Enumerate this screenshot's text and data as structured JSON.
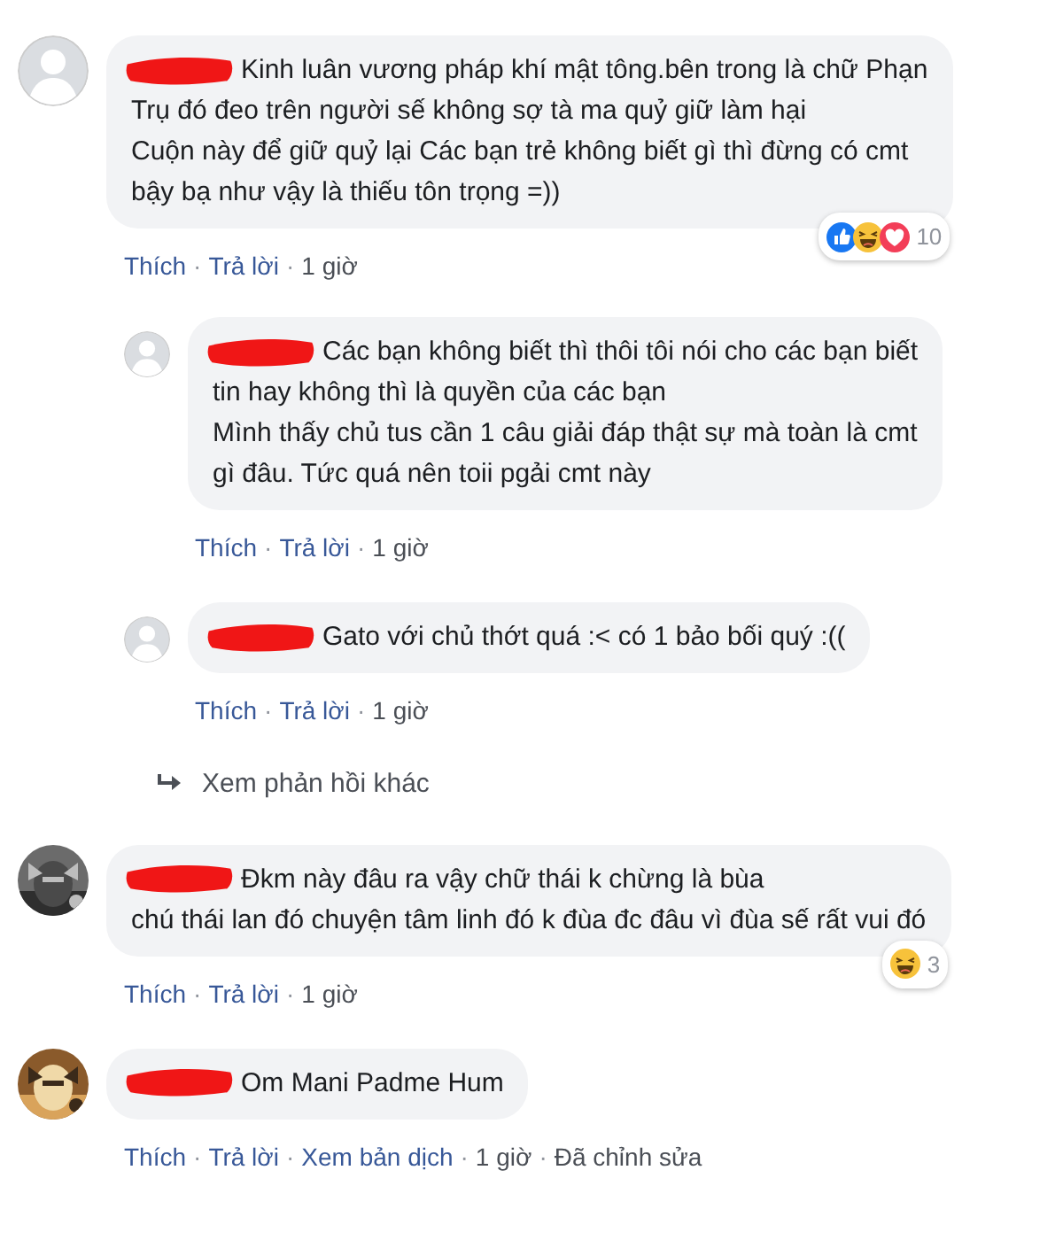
{
  "comments": [
    {
      "avatar": {
        "kind": "default"
      },
      "lines": [
        "Kinh luân vương pháp khí mật tông.bên trong là chữ Phạn",
        "Trụ đó đeo trên người sế không sợ tà ma quỷ giữ làm hại",
        "Cuộn này để giữ quỷ lại Các bạn trẻ không biết gì thì đừng có cmt",
        "bậy bạ như vậy là thiếu tôn trọng =))"
      ],
      "actions": [
        "Thích",
        "Trả lời",
        "1 giờ"
      ],
      "reactions": {
        "icons": [
          {
            "kind": "like"
          },
          {
            "kind": "haha"
          },
          {
            "kind": "love"
          }
        ],
        "count": "10"
      },
      "replies": [
        {
          "avatar": {
            "kind": "default"
          },
          "lines": [
            "Các bạn không biết thì thôi tôi nói cho các bạn biết",
            "tin hay không thì là quyền của các bạn",
            "Mình thấy chủ tus cần 1 câu giải đáp thật sự mà toàn là cmt",
            "gì đâu. Tức quá nên toii pgải cmt này"
          ],
          "actions": [
            "Thích",
            "Trả lời",
            "1 giờ"
          ]
        },
        {
          "avatar": {
            "kind": "default"
          },
          "lines": [
            "Gato với chủ thớt quá :< có 1 bảo bối quý :(("
          ],
          "actions": [
            "Thích",
            "Trả lời",
            "1 giờ"
          ]
        }
      ],
      "more_replies": "Xem phản hồi khác"
    },
    {
      "avatar": {
        "kind": "picture"
      },
      "lines": [
        "Đkm này đâu ra vậy chữ thái k chừng là bùa",
        "chú thái lan đó chuyện tâm linh đó k đùa đc đâu vì đùa sế rất vui đó"
      ],
      "actions": [
        "Thích",
        "Trả lời",
        "1 giờ"
      ],
      "reactions": {
        "icons": [
          {
            "kind": "haha"
          }
        ],
        "count": "3"
      }
    },
    {
      "avatar": {
        "kind": "picture"
      },
      "lines": [
        "Om Mani Padme Hum"
      ],
      "actions": [
        "Thích",
        "Trả lời",
        "Xem bản dịch",
        "1 giờ",
        "Đã chỉnh sửa"
      ]
    }
  ],
  "separator": "·"
}
